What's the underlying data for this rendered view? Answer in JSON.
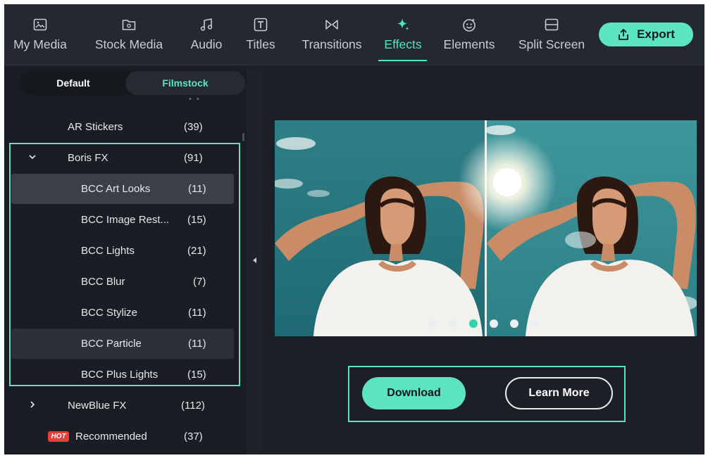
{
  "toolbar": {
    "tabs": [
      {
        "label": "My Media",
        "icon": "image-icon"
      },
      {
        "label": "Stock Media",
        "icon": "folder-icon"
      },
      {
        "label": "Audio",
        "icon": "music-note-icon"
      },
      {
        "label": "Titles",
        "icon": "text-t-icon"
      },
      {
        "label": "Transitions",
        "icon": "transition-bowtie-icon"
      },
      {
        "label": "Effects",
        "icon": "sparkle-icon",
        "active": true
      },
      {
        "label": "Elements",
        "icon": "smiley-icon"
      },
      {
        "label": "Split Screen",
        "icon": "split-screen-icon"
      }
    ],
    "export_label": "Export",
    "export_icon": "upload-icon"
  },
  "sidebar": {
    "segment_default": "Default",
    "segment_filmstock": "Filmstock",
    "segment_active": "Filmstock",
    "items": [
      {
        "name": "AR Stickers",
        "count": "(39)"
      },
      {
        "name": "Boris FX",
        "count": "(91)",
        "expanded": true
      },
      {
        "name": "BCC Art Looks",
        "count": "(11)",
        "selected": true
      },
      {
        "name": "BCC Image Rest...",
        "count": "(15)"
      },
      {
        "name": "BCC Lights",
        "count": "(21)"
      },
      {
        "name": "BCC Blur",
        "count": "(7)"
      },
      {
        "name": "BCC Stylize",
        "count": "(11)"
      },
      {
        "name": "BCC Particle",
        "count": "(11)",
        "hovered": true
      },
      {
        "name": "BCC Plus Lights",
        "count": "(15)"
      },
      {
        "name": "NewBlue FX",
        "count": "(112)",
        "expanded": false
      },
      {
        "name": "Recommended",
        "count": "(37)",
        "badge": "HOT"
      }
    ]
  },
  "preview": {
    "carousel_total": 6,
    "carousel_active": 3
  },
  "actions": {
    "download_label": "Download",
    "learn_more_label": "Learn More"
  },
  "colors": {
    "accent": "#5ce3c2",
    "background": "#1c1f26",
    "hot_badge": "#e53f3a"
  }
}
